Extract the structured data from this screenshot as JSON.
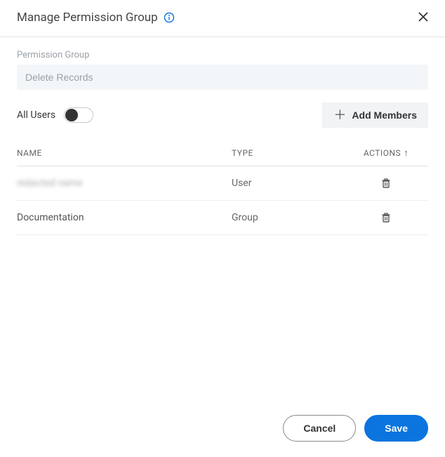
{
  "header": {
    "title": "Manage Permission Group"
  },
  "group_field": {
    "label": "Permission Group",
    "value": "Delete Records"
  },
  "toggle": {
    "label": "All Users",
    "on": false
  },
  "buttons": {
    "add_members": "Add Members",
    "cancel": "Cancel",
    "save": "Save"
  },
  "table": {
    "headers": {
      "name": "NAME",
      "type": "TYPE",
      "actions": "ACTIONS"
    },
    "sort_indicator": "↑",
    "rows": [
      {
        "name": "redacted name",
        "type": "User",
        "blurred": true
      },
      {
        "name": "Documentation",
        "type": "Group",
        "blurred": false
      }
    ]
  }
}
